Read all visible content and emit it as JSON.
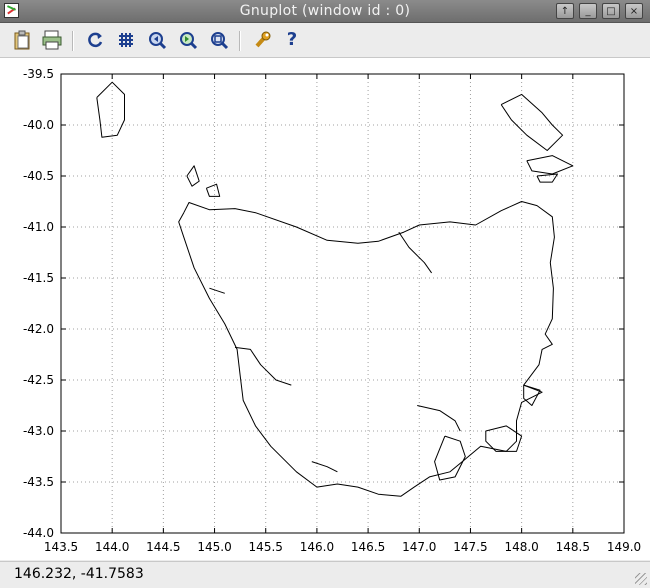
{
  "window": {
    "title": "Gnuplot (window id : 0)",
    "btn_raise": "↑",
    "btn_min": "_",
    "btn_max": "□",
    "btn_close": "×"
  },
  "toolbar": {
    "icons": [
      "clipboard-icon",
      "print-icon",
      "replot-icon",
      "grid-icon",
      "zoom-prev-icon",
      "zoom-next-icon",
      "autoscale-icon",
      "options-icon",
      "help-icon"
    ],
    "help_label": "?"
  },
  "status": {
    "coords": "146.232, -41.7583"
  },
  "colors": {
    "line": "#000000",
    "grid": "#a0a0a0"
  },
  "chart_data": {
    "type": "line",
    "xlim": [
      143.5,
      149.0
    ],
    "ylim": [
      -44.0,
      -39.5
    ],
    "xticks": [
      "143.5",
      "144.0",
      "144.5",
      "145.0",
      "145.5",
      "146.0",
      "146.5",
      "147.0",
      "147.5",
      "148.0",
      "148.5",
      "149.0"
    ],
    "yticks": [
      "-39.5",
      "-40.0",
      "-40.5",
      "-41.0",
      "-41.5",
      "-42.0",
      "-42.5",
      "-43.0",
      "-43.5",
      "-44.0"
    ],
    "grid": true,
    "series": [
      {
        "id": "tasmania-mainland",
        "points": [
          [
            144.7,
            -40.86
          ],
          [
            144.75,
            -40.76
          ],
          [
            144.95,
            -40.83
          ],
          [
            145.2,
            -40.82
          ],
          [
            145.4,
            -40.86
          ],
          [
            145.8,
            -41.0
          ],
          [
            146.1,
            -41.13
          ],
          [
            146.4,
            -41.16
          ],
          [
            146.6,
            -41.14
          ],
          [
            146.85,
            -41.05
          ],
          [
            147.0,
            -40.98
          ],
          [
            147.3,
            -40.95
          ],
          [
            147.55,
            -40.98
          ],
          [
            147.8,
            -40.84
          ],
          [
            148.0,
            -40.75
          ],
          [
            148.15,
            -40.79
          ],
          [
            148.3,
            -40.9
          ],
          [
            148.32,
            -41.1
          ],
          [
            148.28,
            -41.35
          ],
          [
            148.31,
            -41.6
          ],
          [
            148.3,
            -41.9
          ],
          [
            148.23,
            -42.05
          ],
          [
            148.3,
            -42.15
          ],
          [
            148.2,
            -42.2
          ],
          [
            148.17,
            -42.35
          ],
          [
            148.02,
            -42.55
          ],
          [
            148.2,
            -42.62
          ],
          [
            148.0,
            -42.72
          ],
          [
            147.95,
            -42.9
          ],
          [
            147.95,
            -43.1
          ],
          [
            147.85,
            -43.2
          ],
          [
            147.6,
            -43.15
          ],
          [
            147.42,
            -43.3
          ],
          [
            147.3,
            -43.4
          ],
          [
            147.1,
            -43.45
          ],
          [
            146.95,
            -43.55
          ],
          [
            146.82,
            -43.64
          ],
          [
            146.6,
            -43.62
          ],
          [
            146.4,
            -43.55
          ],
          [
            146.2,
            -43.52
          ],
          [
            146.0,
            -43.55
          ],
          [
            145.8,
            -43.4
          ],
          [
            145.55,
            -43.15
          ],
          [
            145.4,
            -42.95
          ],
          [
            145.28,
            -42.7
          ],
          [
            145.25,
            -42.45
          ],
          [
            145.22,
            -42.2
          ],
          [
            145.1,
            -41.95
          ],
          [
            144.95,
            -41.7
          ],
          [
            144.8,
            -41.4
          ],
          [
            144.7,
            -41.1
          ],
          [
            144.65,
            -40.95
          ],
          [
            144.7,
            -40.86
          ]
        ]
      },
      {
        "id": "king-island",
        "points": [
          [
            143.85,
            -39.73
          ],
          [
            144.0,
            -39.58
          ],
          [
            144.12,
            -39.7
          ],
          [
            144.12,
            -39.95
          ],
          [
            144.05,
            -40.1
          ],
          [
            143.9,
            -40.12
          ],
          [
            143.88,
            -39.95
          ],
          [
            143.85,
            -39.73
          ]
        ]
      },
      {
        "id": "flinders-island",
        "points": [
          [
            147.8,
            -39.8
          ],
          [
            148.0,
            -39.7
          ],
          [
            148.2,
            -39.88
          ],
          [
            148.3,
            -40.0
          ],
          [
            148.4,
            -40.1
          ],
          [
            148.25,
            -40.25
          ],
          [
            148.05,
            -40.1
          ],
          [
            147.9,
            -39.95
          ],
          [
            147.8,
            -39.8
          ]
        ]
      },
      {
        "id": "cape-barren-island",
        "points": [
          [
            148.05,
            -40.35
          ],
          [
            148.3,
            -40.3
          ],
          [
            148.5,
            -40.4
          ],
          [
            148.3,
            -40.48
          ],
          [
            148.1,
            -40.45
          ],
          [
            148.05,
            -40.35
          ]
        ]
      },
      {
        "id": "clarke-island",
        "points": [
          [
            148.15,
            -40.5
          ],
          [
            148.35,
            -40.48
          ],
          [
            148.3,
            -40.56
          ],
          [
            148.18,
            -40.56
          ],
          [
            148.15,
            -40.5
          ]
        ]
      },
      {
        "id": "three-hummock-island",
        "points": [
          [
            144.73,
            -40.5
          ],
          [
            144.8,
            -40.4
          ],
          [
            144.85,
            -40.55
          ],
          [
            144.78,
            -40.6
          ],
          [
            144.73,
            -40.5
          ]
        ]
      },
      {
        "id": "robbins-island",
        "points": [
          [
            144.92,
            -40.62
          ],
          [
            145.02,
            -40.58
          ],
          [
            145.05,
            -40.7
          ],
          [
            144.95,
            -40.7
          ],
          [
            144.92,
            -40.62
          ]
        ]
      },
      {
        "id": "tamar-estuary",
        "points": [
          [
            146.8,
            -41.05
          ],
          [
            146.9,
            -41.2
          ],
          [
            147.05,
            -41.35
          ],
          [
            147.12,
            -41.45
          ]
        ]
      },
      {
        "id": "maria-island",
        "points": [
          [
            148.02,
            -42.55
          ],
          [
            148.18,
            -42.6
          ],
          [
            148.1,
            -42.75
          ],
          [
            148.02,
            -42.68
          ],
          [
            148.02,
            -42.55
          ]
        ]
      },
      {
        "id": "bruny-island",
        "points": [
          [
            147.25,
            -43.05
          ],
          [
            147.4,
            -43.1
          ],
          [
            147.45,
            -43.25
          ],
          [
            147.35,
            -43.45
          ],
          [
            147.2,
            -43.48
          ],
          [
            147.15,
            -43.3
          ],
          [
            147.25,
            -43.05
          ]
        ]
      },
      {
        "id": "tasman-peninsula",
        "points": [
          [
            147.65,
            -43.0
          ],
          [
            147.85,
            -42.95
          ],
          [
            148.0,
            -43.05
          ],
          [
            147.95,
            -43.2
          ],
          [
            147.75,
            -43.2
          ],
          [
            147.65,
            -43.1
          ],
          [
            147.65,
            -43.0
          ]
        ]
      },
      {
        "id": "derwent-estuary",
        "points": [
          [
            146.98,
            -42.75
          ],
          [
            147.2,
            -42.8
          ],
          [
            147.35,
            -42.9
          ],
          [
            147.4,
            -43.0
          ]
        ]
      },
      {
        "id": "macquarie-harbour",
        "points": [
          [
            145.2,
            -42.18
          ],
          [
            145.35,
            -42.2
          ],
          [
            145.45,
            -42.35
          ],
          [
            145.6,
            -42.5
          ],
          [
            145.75,
            -42.55
          ]
        ]
      },
      {
        "id": "port-davey",
        "points": [
          [
            145.95,
            -43.3
          ],
          [
            146.1,
            -43.35
          ],
          [
            146.2,
            -43.4
          ]
        ]
      },
      {
        "id": "arthur-river",
        "points": [
          [
            144.95,
            -41.6
          ],
          [
            145.1,
            -41.65
          ]
        ]
      }
    ]
  }
}
